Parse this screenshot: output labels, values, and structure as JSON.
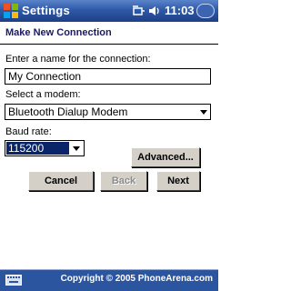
{
  "status_bar": {
    "title": "Settings",
    "time": "11:03"
  },
  "page": {
    "title": "Make New Connection"
  },
  "form": {
    "name_label": "Enter a name for the connection:",
    "name_value": "My Connection",
    "modem_label": "Select a modem:",
    "modem_value": "Bluetooth Dialup Modem",
    "baud_label": "Baud rate:",
    "baud_value": "115200"
  },
  "buttons": {
    "advanced": "Advanced...",
    "cancel": "Cancel",
    "back": "Back",
    "next": "Next"
  },
  "footer": {
    "copyright": "Copyright © 2005 PhoneArena.com"
  },
  "icons": {
    "start": "windows-flag-icon",
    "connectivity": "connectivity-icon",
    "volume": "speaker-icon",
    "keyboard": "keyboard-icon"
  },
  "colors": {
    "title_bar": "#2f5aa8",
    "selection": "#0a246a",
    "button_face": "#d4d0c8"
  }
}
